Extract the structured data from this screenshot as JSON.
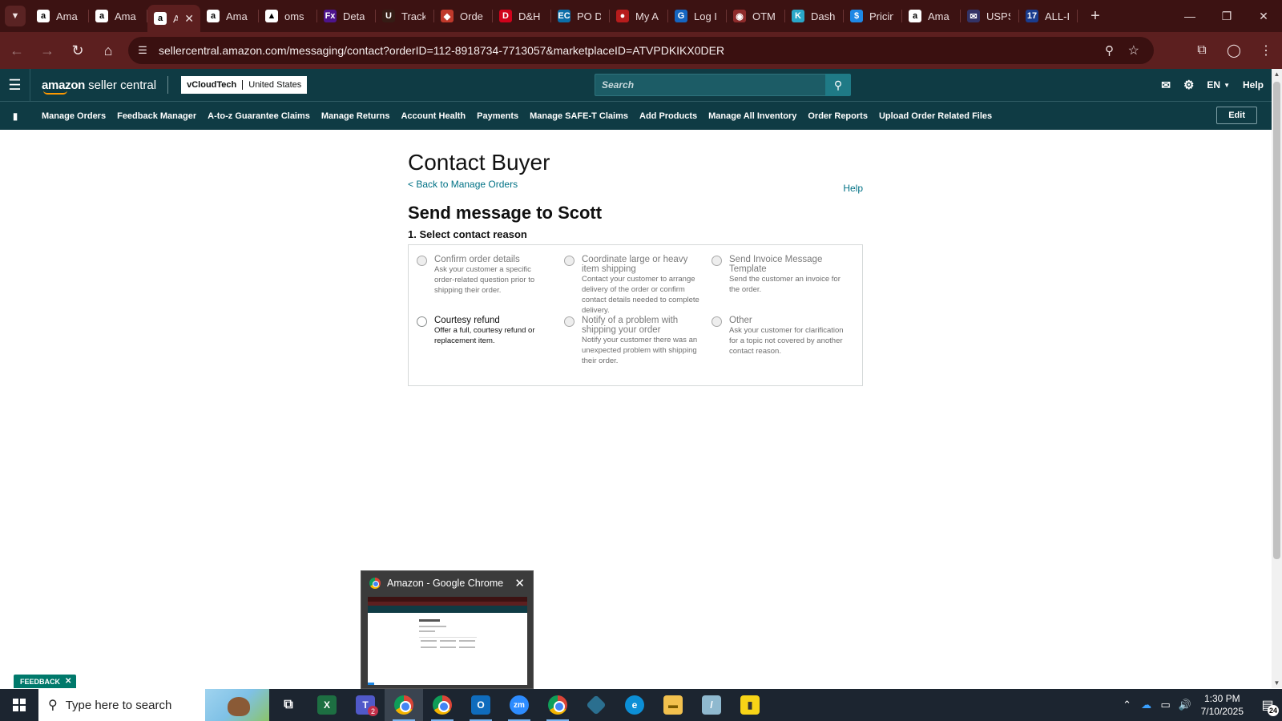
{
  "browser": {
    "tabs": [
      {
        "label": "Ama",
        "favicon_text": "a",
        "favicon_color": "#000000",
        "active": false
      },
      {
        "label": "Ama",
        "favicon_text": "a",
        "favicon_color": "#000000",
        "active": false
      },
      {
        "label": "A",
        "favicon_text": "a",
        "favicon_color": "#000000",
        "active": true
      },
      {
        "label": "Ama",
        "favicon_text": "a",
        "favicon_color": "#000000",
        "active": false
      },
      {
        "label": "oms",
        "favicon_text": "▲",
        "favicon_color": "#000000",
        "active": false
      },
      {
        "label": "Deta",
        "favicon_text": "Fx",
        "favicon_color": "#4d148c",
        "active": false
      },
      {
        "label": "Track",
        "favicon_text": "U",
        "favicon_color": "#351c15",
        "active": false
      },
      {
        "label": "Orde",
        "favicon_text": "◆",
        "favicon_color": "#c0392b",
        "active": false
      },
      {
        "label": "D&H",
        "favicon_text": "D",
        "favicon_color": "#d0021b",
        "active": false
      },
      {
        "label": "PO D",
        "favicon_text": "EC",
        "favicon_color": "#0b6ea8",
        "active": false
      },
      {
        "label": "My A",
        "favicon_text": "●",
        "favicon_color": "#b71c1c",
        "active": false
      },
      {
        "label": "Log I",
        "favicon_text": "G",
        "favicon_color": "#1565c0",
        "active": false
      },
      {
        "label": "OTM",
        "favicon_text": "◉",
        "favicon_color": "#8e2b2b",
        "active": false
      },
      {
        "label": "Dash",
        "favicon_text": "K",
        "favicon_color": "#2aa7c9",
        "active": false
      },
      {
        "label": "Pricin",
        "favicon_text": "$",
        "favicon_color": "#1e88e5",
        "active": false
      },
      {
        "label": "Ama",
        "favicon_text": "a",
        "favicon_color": "#000000",
        "active": false
      },
      {
        "label": "USPS",
        "favicon_text": "✉",
        "favicon_color": "#333366",
        "active": false
      },
      {
        "label": "ALL-I",
        "favicon_text": "17",
        "favicon_color": "#1a3c8e",
        "active": false
      }
    ],
    "url": "sellercentral.amazon.com/messaging/contact?orderID=112-8918734-7713057&marketplaceID=ATVPDKIKX0DER"
  },
  "header": {
    "logo_bold": "amazon",
    "logo_rest": "seller central",
    "store_name": "vCloudTech",
    "marketplace": "United States",
    "search_placeholder": "Search",
    "language": "EN",
    "help": "Help",
    "accent_color": "#ff9900"
  },
  "nav": {
    "links": [
      "Manage Orders",
      "Feedback Manager",
      "A-to-z Guarantee Claims",
      "Manage Returns",
      "Account Health",
      "Payments",
      "Manage SAFE-T Claims",
      "Add Products",
      "Manage All Inventory",
      "Order Reports",
      "Upload Order Related Files"
    ],
    "edit": "Edit"
  },
  "page": {
    "title": "Contact Buyer",
    "back_link": "< Back to Manage Orders",
    "help": "Help",
    "message_title": "Send message to Scott",
    "step_title": "1. Select contact reason",
    "reasons": [
      {
        "label": "Confirm order details",
        "desc": "Ask your customer a specific order-related question prior to shipping their order.",
        "enabled": false
      },
      {
        "label": "Coordinate large or heavy item shipping",
        "desc": "Contact your customer to arrange delivery of the order or confirm contact details needed to complete delivery.",
        "enabled": false
      },
      {
        "label": "Send Invoice Message Template",
        "desc": "Send the customer an invoice for the order.",
        "enabled": false
      },
      {
        "label": "Courtesy refund",
        "desc": "Offer a full, courtesy refund or replacement item.",
        "enabled": true
      },
      {
        "label": "Notify of a problem with shipping your order",
        "desc": "Notify your customer there was an unexpected problem with shipping their order.",
        "enabled": false
      },
      {
        "label": "Other",
        "desc": "Ask your customer for clarification for a topic not covered by another contact reason.",
        "enabled": false
      }
    ]
  },
  "feedback": {
    "label": "FEEDBACK"
  },
  "preview": {
    "title": "Amazon - Google Chrome"
  },
  "taskbar": {
    "search_text": "Type here to search",
    "teams_badge": "2",
    "time": "1:30 PM",
    "date": "7/10/2025",
    "notification_count": "24"
  }
}
